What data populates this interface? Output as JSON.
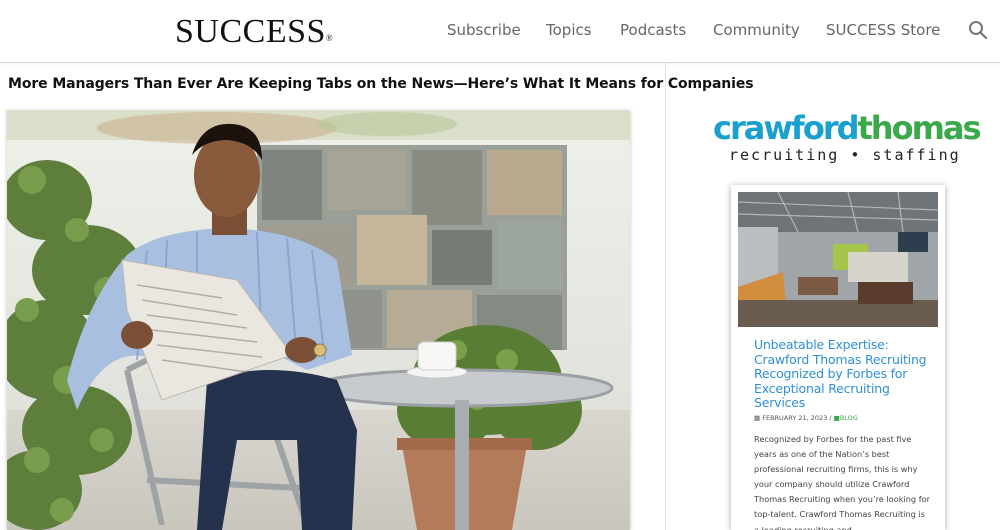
{
  "header": {
    "logo": "SUCCESS",
    "logo_mark": "®",
    "nav": [
      "Subscribe",
      "Topics",
      "Podcasts",
      "Community",
      "SUCCESS Store"
    ],
    "search_icon": "search-icon"
  },
  "article": {
    "headline": "More Managers Than Ever Are Keeping Tabs on the News—Here’s What It Means for Companies"
  },
  "sidebar": {
    "ad_logo": {
      "word1": "crawford",
      "word2": "thomas",
      "tagline": "recruiting • staffing"
    },
    "card": {
      "title": "Unbeatable Expertise: Crawford Thomas Recruiting Recognized by Forbes for Exceptional Recruiting Services",
      "date": "FEBRUARY 21, 2023",
      "category": "BLOG",
      "excerpt": "Recognized by Forbes for the past five years as one of the Nation’s best professional recruiting firms, this is why your company should utilize Crawford Thomas Recruiting when you’re looking for top-talent. Crawford Thomas Recruiting is a leading recruiting and ..."
    }
  },
  "colors": {
    "brand_blue": "#1aa0cf",
    "brand_green": "#39a94a",
    "link_blue": "#2f8fd3"
  }
}
